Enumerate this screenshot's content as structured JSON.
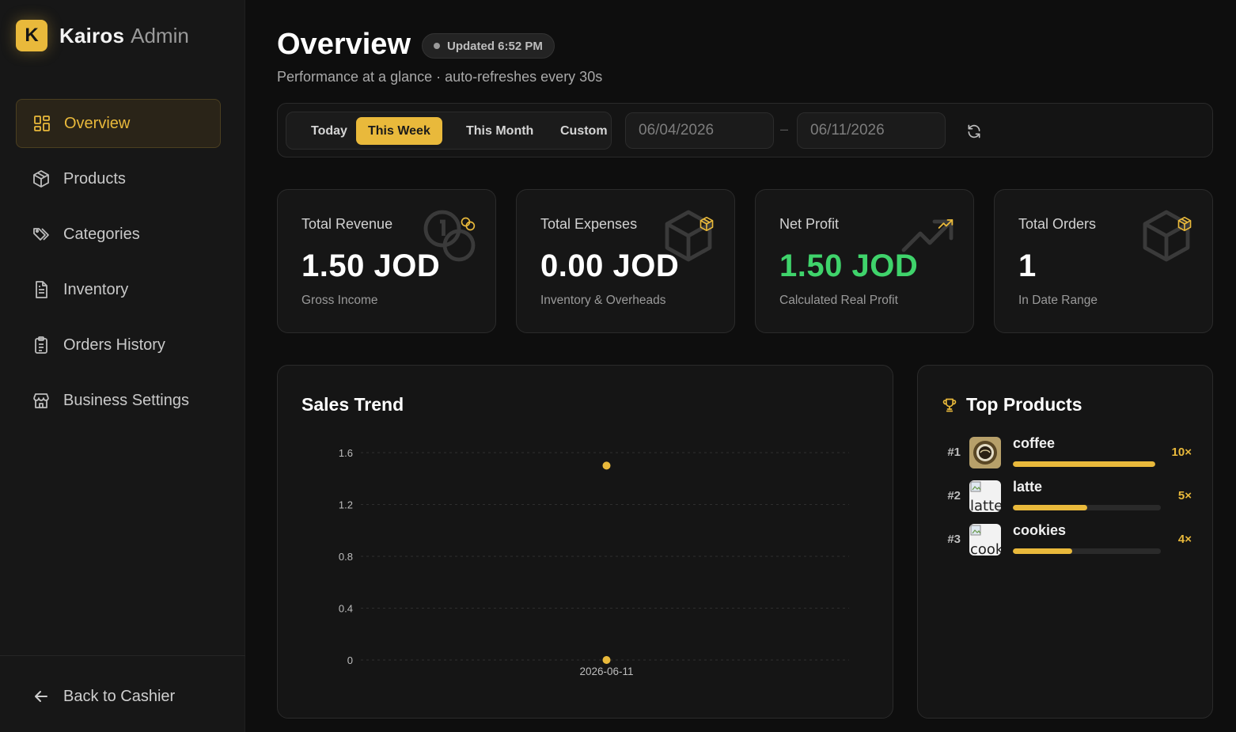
{
  "brand": {
    "logo_letter": "K",
    "name": "Kairos",
    "sub": "Admin"
  },
  "sidebar": {
    "items": [
      {
        "label": "Overview",
        "icon": "dashboard-grid-icon",
        "active": true
      },
      {
        "label": "Products",
        "icon": "box-icon",
        "active": false
      },
      {
        "label": "Categories",
        "icon": "tags-icon",
        "active": false
      },
      {
        "label": "Inventory",
        "icon": "document-icon",
        "active": false
      },
      {
        "label": "Orders History",
        "icon": "clipboard-list-icon",
        "active": false
      },
      {
        "label": "Business Settings",
        "icon": "store-icon",
        "active": false
      }
    ],
    "back_label": "Back to Cashier"
  },
  "header": {
    "title": "Overview",
    "updated": "Updated 6:52 PM",
    "subtitle": "Performance at a glance · auto-refreshes every 30s"
  },
  "filters": {
    "ranges": [
      "Today",
      "This Week",
      "This Month",
      "Custom"
    ],
    "active_range": "This Week",
    "date_from": "06/04/2026",
    "date_to": "06/11/2026",
    "separator": "–"
  },
  "stats": [
    {
      "label": "Total Revenue",
      "value": "1.50 JOD",
      "sub": "Gross Income",
      "icon": "coins-icon"
    },
    {
      "label": "Total Expenses",
      "value": "0.00 JOD",
      "sub": "Inventory & Overheads",
      "icon": "package-icon"
    },
    {
      "label": "Net Profit",
      "value": "1.50 JOD",
      "sub": "Calculated Real Profit",
      "icon": "trending-up-icon"
    },
    {
      "label": "Total Orders",
      "value": "1",
      "sub": "In Date Range",
      "icon": "package-icon"
    }
  ],
  "sales_trend": {
    "title": "Sales Trend"
  },
  "chart_data": {
    "type": "scatter",
    "title": "Sales Trend",
    "xlabel": "",
    "ylabel": "",
    "x": [
      "2026-06-11",
      "2026-06-11"
    ],
    "y": [
      1.5,
      0
    ],
    "yticks": [
      0,
      0.4,
      0.8,
      1.2,
      1.6
    ],
    "xticks": [
      "2026-06-11"
    ],
    "ylim": [
      0,
      1.6
    ],
    "grid": true,
    "color": "#e9b93b"
  },
  "top_products": {
    "title": "Top Products",
    "items": [
      {
        "rank": "#1",
        "name": "coffee",
        "count": "10×",
        "share": 1.0,
        "thumb_alt": ""
      },
      {
        "rank": "#2",
        "name": "latte",
        "count": "5×",
        "share": 0.5,
        "thumb_alt": "latte"
      },
      {
        "rank": "#3",
        "name": "cookies",
        "count": "4×",
        "share": 0.4,
        "thumb_alt": "cookies"
      }
    ]
  },
  "colors": {
    "accent": "#e9b93b",
    "profit": "#3fd36b",
    "background": "#0e0e0e",
    "card": "#161616"
  }
}
